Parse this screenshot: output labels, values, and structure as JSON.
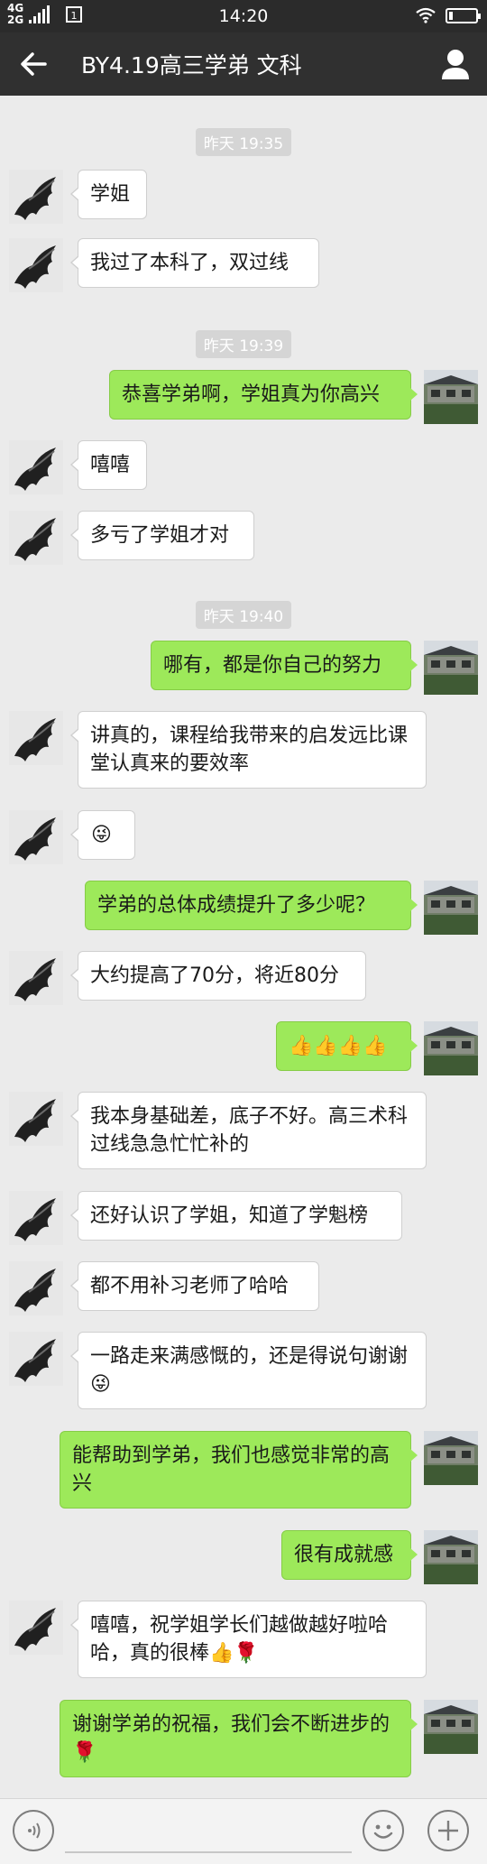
{
  "status_bar": {
    "network_top": "4G",
    "network_bottom": "2G",
    "time": "14:20"
  },
  "header": {
    "title": "BY4.19高三学弟 文科",
    "back_icon": "arrow-left-icon",
    "profile_icon": "person-icon"
  },
  "timestamps": [
    "昨天 19:35",
    "昨天 19:39",
    "昨天 19:40"
  ],
  "messages": [
    {
      "side": "in",
      "text": "学姐"
    },
    {
      "side": "in",
      "text": "我过了本科了，双过线"
    },
    {
      "side": "out",
      "text": "恭喜学弟啊，学姐真为你高兴"
    },
    {
      "side": "in",
      "text": "嘻嘻"
    },
    {
      "side": "in",
      "text": "多亏了学姐才对"
    },
    {
      "side": "out",
      "text": "哪有，都是你自己的努力"
    },
    {
      "side": "in",
      "text": "讲真的，课程给我带来的启发远比课堂认真来的要效率"
    },
    {
      "side": "in",
      "text": "😜"
    },
    {
      "side": "out",
      "text": "学弟的总体成绩提升了多少呢？"
    },
    {
      "side": "in",
      "text": "大约提高了70分，将近80分"
    },
    {
      "side": "out",
      "text": "👍👍👍👍"
    },
    {
      "side": "in",
      "text": "我本身基础差，底子不好。高三术科过线急急忙忙补的"
    },
    {
      "side": "in",
      "text": "还好认识了学姐，知道了学魁榜"
    },
    {
      "side": "in",
      "text": "都不用补习老师了哈哈"
    },
    {
      "side": "in",
      "text": "一路走来满感慨的，还是得说句谢谢😜"
    },
    {
      "side": "out",
      "text": "能帮助到学弟，我们也感觉非常的高兴"
    },
    {
      "side": "out",
      "text": "很有成就感"
    },
    {
      "side": "in",
      "text": "嘻嘻，祝学姐学长们越做越好啦哈哈，真的很棒👍🌹"
    },
    {
      "side": "out",
      "text": "谢谢学弟的祝福，我们会不断进步的🌹"
    }
  ],
  "input_bar": {
    "voice_icon": "voice-icon",
    "emoji_icon": "smiley-icon",
    "more_icon": "plus-icon"
  },
  "colors": {
    "status_bar": "#2b2b2b",
    "title_bar": "#303030",
    "background": "#ebebeb",
    "incoming_bubble": "#ffffff",
    "outgoing_bubble": "#9de95a",
    "timestamp_bg": "#d5d5d5"
  }
}
